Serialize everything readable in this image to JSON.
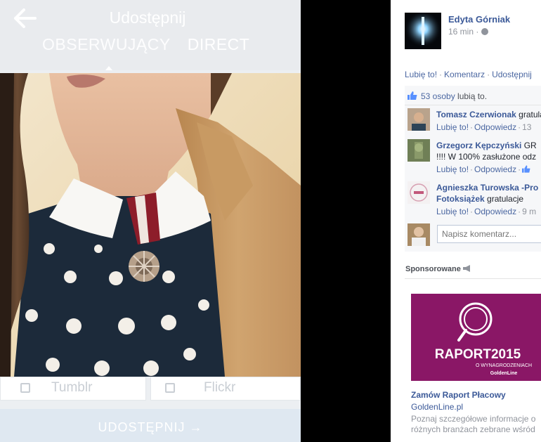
{
  "instagram_share": {
    "title": "Udostępnij",
    "tabs": [
      "OBSERWUJĄCY",
      "DIRECT"
    ],
    "share_options": [
      {
        "label": "Tumblr",
        "icon": "tumblr-icon"
      },
      {
        "label": "Flickr",
        "icon": "flickr-icon"
      }
    ],
    "submit_label": "UDOSTĘPNIJ →"
  },
  "facebook_post": {
    "author": "Edyta Górniak",
    "time": "16 min ·",
    "actions": [
      "Lubię to!",
      "Komentarz",
      "Udostępnij"
    ],
    "likes": {
      "count_text": "53 osoby",
      "suffix": " lubią to."
    },
    "comments": [
      {
        "author": "Tomasz Czerwionak",
        "text": " gratulacje",
        "line2": "",
        "meta": {
          "like": "Lubię to!",
          "reply": "Odpowiedz",
          "time": "13"
        }
      },
      {
        "author": "Grzegorz Kępczyński",
        "text": " GR",
        "line2": "!!!! W 100% zasłużone odz",
        "meta": {
          "like": "Lubię to!",
          "reply": "Odpowiedz",
          "time": ""
        }
      },
      {
        "author": "Agnieszka Turowska -Pro",
        "text": "",
        "line2_bold": "Fotoksiążek",
        "line2": " gratulacje",
        "meta": {
          "like": "Lubię to!",
          "reply": "Odpowiedz",
          "time": "9 m"
        }
      }
    ],
    "comment_placeholder": "Napisz komentarz..."
  },
  "sponsored": {
    "label": "Sponsorowane",
    "ad_image_text": {
      "main": "RAPORT2015",
      "sub": "O WYNAGRODZENIACH",
      "brand": "GoldenLine"
    },
    "title": "Zamów Raport Płacowy",
    "domain": "GoldenLine.pl",
    "description": [
      "Poznaj szczegółowe informacje o",
      "różnych branżach zebrane wśród"
    ]
  },
  "colors": {
    "fb_link": "#3b5998",
    "ad_background": "#8a1766",
    "coat": "#c79a63",
    "sweater": "#1c2a3a"
  }
}
